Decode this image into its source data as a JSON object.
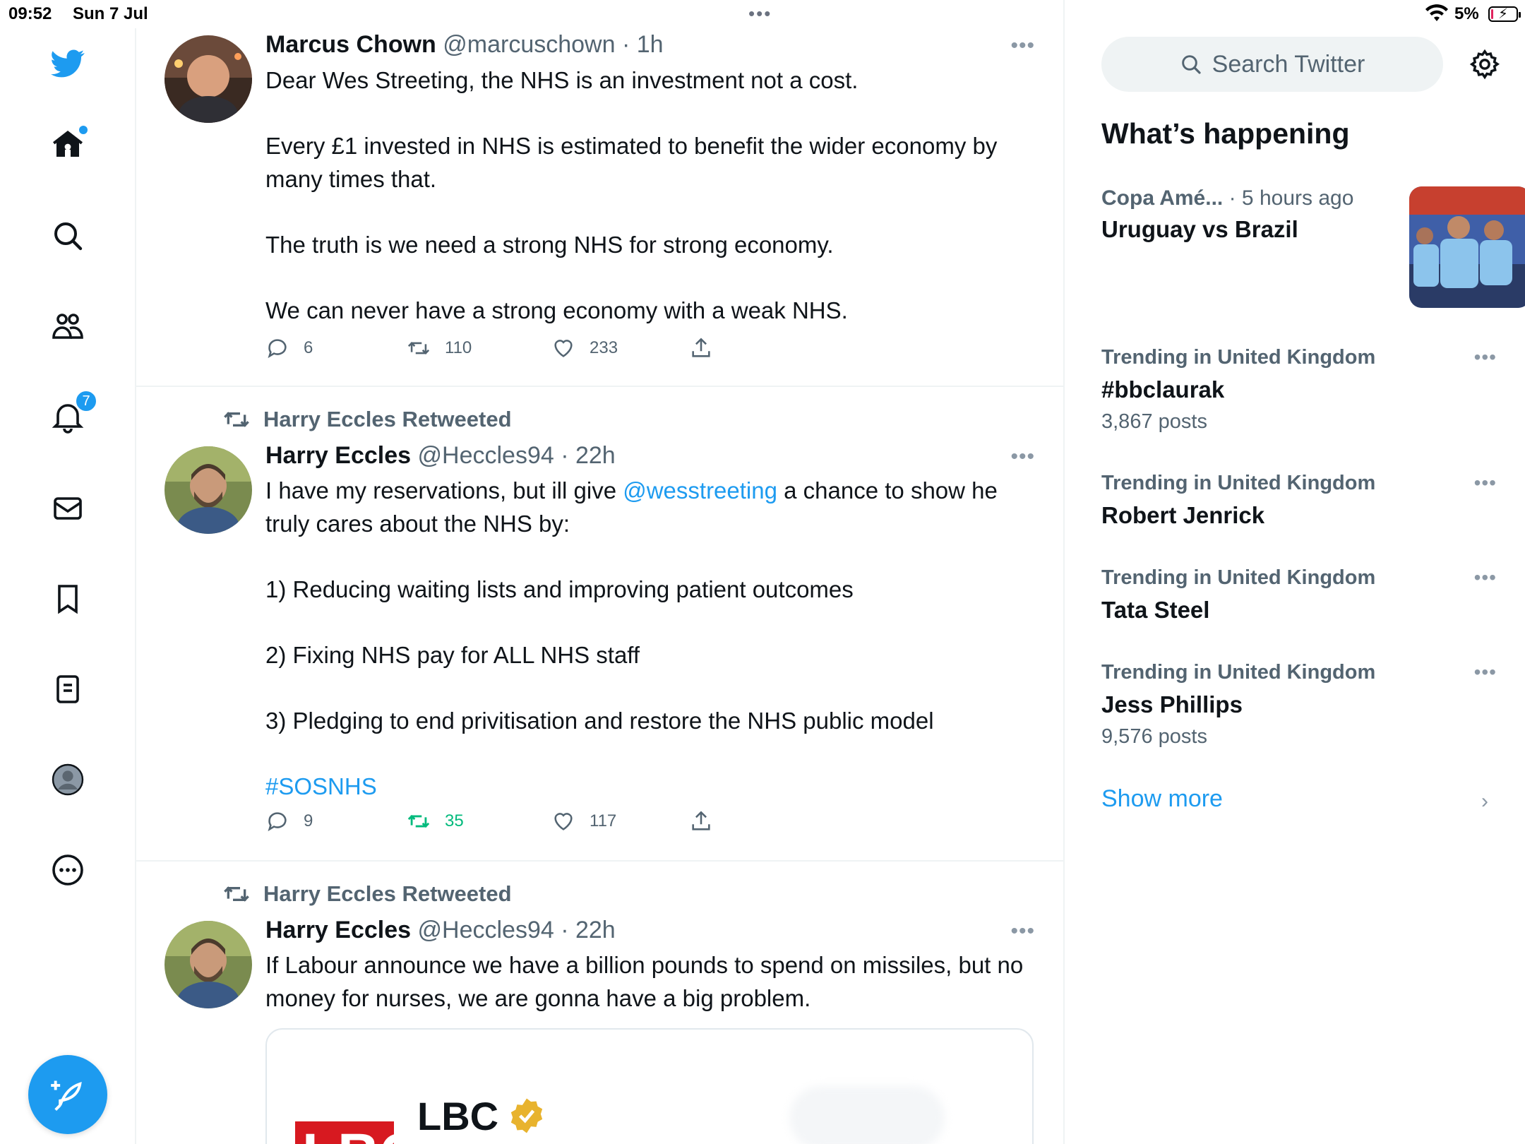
{
  "status_bar": {
    "time": "09:52",
    "date": "Sun 7 Jul",
    "battery": "5%"
  },
  "nav": {
    "items": [
      "twitter-logo",
      "home",
      "explore",
      "communities",
      "notifications",
      "messages",
      "bookmarks",
      "lists",
      "profile",
      "more"
    ],
    "notification_count": "7"
  },
  "tweets": [
    {
      "name": "Marcus Chown",
      "handle": "@marcuschown",
      "time": "· 1h",
      "body": [
        "Dear Wes Streeting, the NHS is an investment not a cost.",
        "Every £1 invested in NHS is estimated to benefit the wider economy by many times that.",
        "The truth is we need a strong NHS for strong economy.",
        "We can never have a strong economy with a weak NHS."
      ],
      "replies": "6",
      "retweets": "110",
      "likes": "233"
    },
    {
      "retweeted_by": "Harry Eccles Retweeted",
      "name": "Harry Eccles",
      "handle": "@Heccles94",
      "time": "· 22h",
      "body_intro_before": "I have my reservations, but ill give ",
      "mention": "@wesstreeting",
      "body_intro_after": " a chance to show he truly cares about the NHS by:",
      "body": [
        "1) Reducing waiting lists and improving patient outcomes",
        "2) Fixing NHS pay for ALL NHS staff",
        "3) Pledging to end privitisation and restore the NHS public model"
      ],
      "hashtag": "#SOSNHS",
      "replies": "9",
      "retweets": "35",
      "likes": "117"
    },
    {
      "retweeted_by": "Harry Eccles Retweeted",
      "name": "Harry Eccles",
      "handle": "@Heccles94",
      "time": "· 22h",
      "body": "If Labour announce we have a billion pounds to spend on missiles, but no money for nurses, we are gonna have a big problem.",
      "card": {
        "name": "LBC",
        "logo_text": "LBC"
      }
    }
  ],
  "sidebar": {
    "search_placeholder": "Search Twitter",
    "section_title": "What’s happening",
    "news": {
      "category": "Copa Amé...",
      "time": "· 5 hours ago",
      "title": "Uruguay vs Brazil"
    },
    "trends": [
      {
        "context": "Trending in United Kingdom",
        "name": "#bbclaurak",
        "count": "3,867 posts"
      },
      {
        "context": "Trending in United Kingdom",
        "name": "Robert Jenrick",
        "count": ""
      },
      {
        "context": "Trending in United Kingdom",
        "name": "Tata Steel",
        "count": ""
      },
      {
        "context": "Trending in United Kingdom",
        "name": "Jess Phillips",
        "count": "9,576 posts"
      }
    ],
    "show_more": "Show more"
  },
  "colors": {
    "accent": "#1d9bf0",
    "retweet_active": "#00ba7c",
    "secondary_text": "#536471"
  }
}
